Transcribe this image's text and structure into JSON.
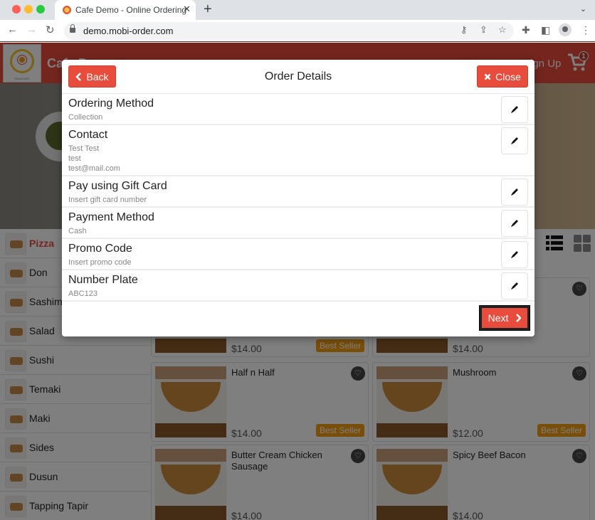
{
  "browser": {
    "tab_title": "Cafe Demo - Online Ordering",
    "url": "demo.mobi-order.com"
  },
  "site": {
    "brand": "Cafe Demo",
    "signup_label": "Sign Up",
    "cart_count": "1",
    "logo_text": "MOBICAFE",
    "accent_color": "#e84c3d"
  },
  "categories": [
    {
      "label": "Pizza",
      "active": true
    },
    {
      "label": "Don"
    },
    {
      "label": "Sashimi"
    },
    {
      "label": "Salad"
    },
    {
      "label": "Sushi"
    },
    {
      "label": "Temaki"
    },
    {
      "label": "Maki"
    },
    {
      "label": "Sides"
    },
    {
      "label": "Dusun"
    },
    {
      "label": "Tapping Tapir"
    }
  ],
  "products": [
    {
      "name": "",
      "price": "$14.00",
      "badge": "Best Seller"
    },
    {
      "name": "",
      "price": "$14.00",
      "badge": ""
    },
    {
      "name": "Half n Half",
      "price": "$14.00",
      "badge": "Best Seller"
    },
    {
      "name": "Mushroom",
      "price": "$12.00",
      "badge": "Best Seller"
    },
    {
      "name": "Butter Cream Chicken Sausage",
      "price": "$14.00",
      "badge": ""
    },
    {
      "name": "Spicy Beef Bacon",
      "price": "$14.00",
      "badge": ""
    }
  ],
  "modal": {
    "title": "Order Details",
    "back_label": "Back",
    "close_label": "Close",
    "next_label": "Next",
    "rows": [
      {
        "title": "Ordering Method",
        "lines": [
          "Collection"
        ]
      },
      {
        "title": "Contact",
        "lines": [
          "Test Test",
          "test",
          "test@mail.com"
        ]
      },
      {
        "title": "Pay using Gift Card",
        "lines": [
          "Insert gift card number"
        ]
      },
      {
        "title": "Payment Method",
        "lines": [
          "Cash"
        ]
      },
      {
        "title": "Promo Code",
        "lines": [
          "Insert promo code"
        ]
      },
      {
        "title": "Number Plate",
        "lines": [
          "ABC123"
        ]
      }
    ]
  }
}
